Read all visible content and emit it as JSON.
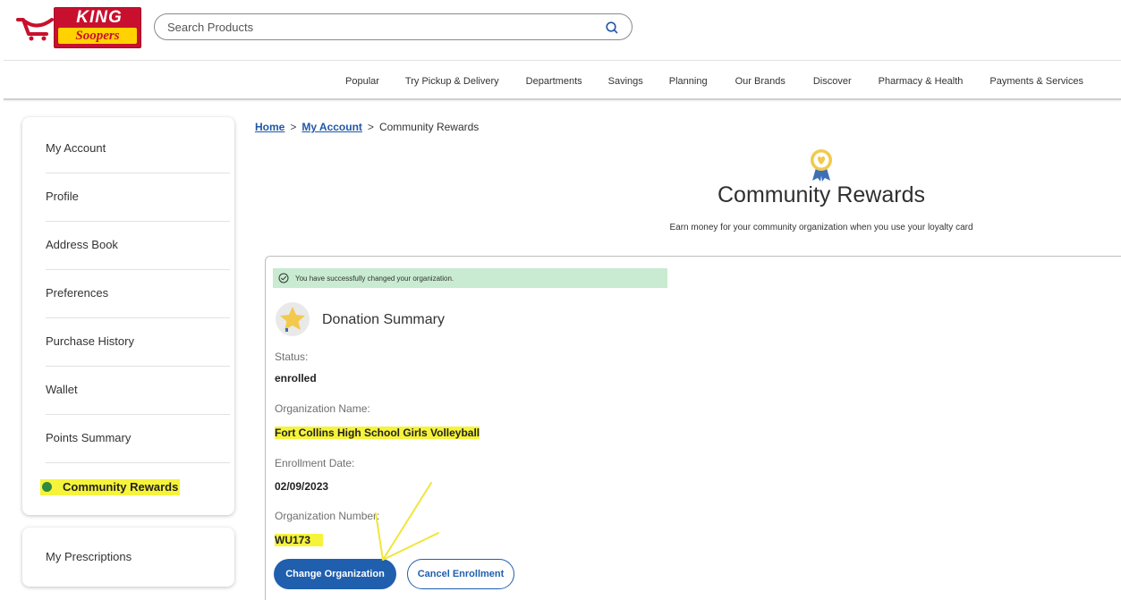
{
  "header": {
    "logo_primary": "KING",
    "logo_secondary": "Soopers",
    "search_placeholder": "Search Products"
  },
  "nav": {
    "items": [
      "Popular",
      "Try Pickup & Delivery",
      "Departments",
      "Savings",
      "Planning",
      "Our Brands",
      "Discover",
      "Pharmacy & Health",
      "Payments & Services"
    ]
  },
  "sidebar": {
    "items": [
      "My Account",
      "Profile",
      "Address Book",
      "Preferences",
      "Purchase History",
      "Wallet",
      "Points Summary",
      "Community Rewards"
    ],
    "active_item": "Community Rewards",
    "prescriptions": "My Prescriptions"
  },
  "breadcrumb": {
    "home": "Home",
    "separator": ">",
    "account": "My Account",
    "current": "Community Rewards"
  },
  "page": {
    "title": "Community Rewards",
    "subtitle": "Earn money for your community organization when you use your loyalty card"
  },
  "notice": {
    "success_text": "You have successfully changed your organization."
  },
  "summary": {
    "title": "Donation Summary",
    "status_label": "Status:",
    "status_value": "enrolled",
    "org_name_label": "Organization Name:",
    "org_name_value": "Fort Collins High School Girls Volleyball",
    "enrollment_label": "Enrollment Date:",
    "enrollment_value": "02/09/2023",
    "org_number_label": "Organization Number:",
    "org_number_value": "WU173"
  },
  "actions": {
    "change": "Change Organization",
    "cancel": "Cancel Enrollment"
  },
  "colors": {
    "brand_red": "#c8102e",
    "brand_yellow": "#ffd200",
    "primary_blue": "#1f5fae",
    "link_blue": "#1f57a6",
    "success_bg": "#c8ebd1",
    "highlight_yellow": "#f6f33b",
    "active_dot_green": "#2e8b3e"
  },
  "icons": {
    "logo": "cart-logo-icon",
    "search": "search-icon",
    "ribbon": "award-ribbon-icon",
    "check": "check-circle-icon",
    "star": "star-badge-icon"
  }
}
